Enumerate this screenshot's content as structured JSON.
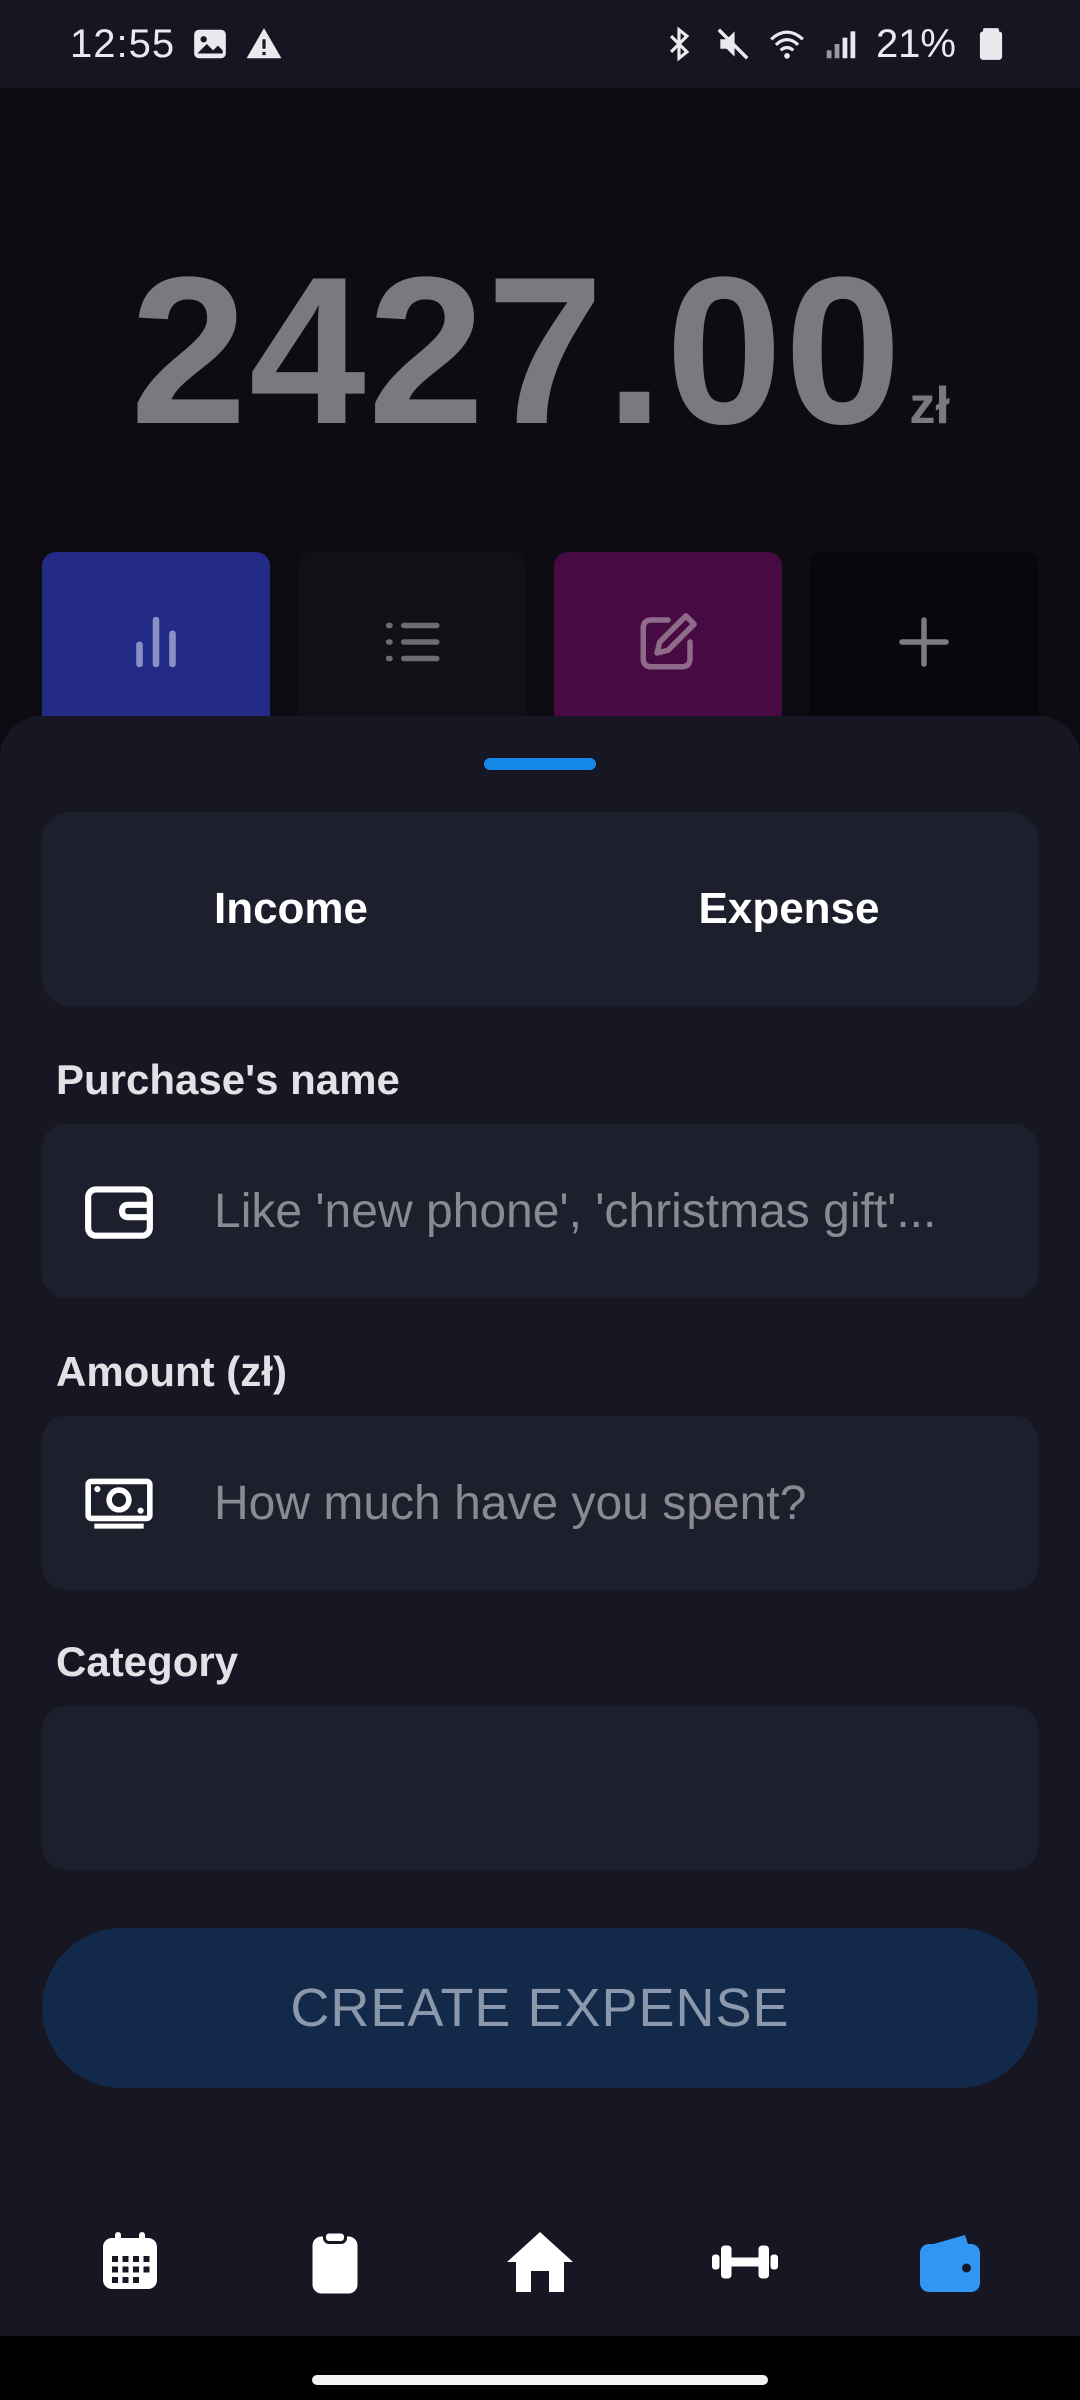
{
  "status_bar": {
    "time": "12:55",
    "battery_percent": "21%",
    "icons_left": [
      "gallery-icon",
      "alert-icon"
    ],
    "icons_right": [
      "bluetooth-icon",
      "mute-icon",
      "wifi-icon",
      "signal-icon",
      "battery-icon"
    ]
  },
  "balance": {
    "amount": "2427.00",
    "currency": "zł"
  },
  "tiles": [
    {
      "icon": "bar-chart-icon",
      "color": "#242b87"
    },
    {
      "icon": "list-icon",
      "color": "#101117"
    },
    {
      "icon": "edit-icon",
      "color": "#480a43"
    },
    {
      "icon": "plus-icon",
      "color": "#07070c"
    }
  ],
  "segment": {
    "income_label": "Income",
    "expense_label": "Expense"
  },
  "form": {
    "name_label": "Purchase's name",
    "name_placeholder": "Like 'new phone', 'christmas gift'...",
    "name_value": "",
    "amount_label": "Amount (zł)",
    "amount_placeholder": "How much have you spent?",
    "amount_value": "",
    "category_label": "Category",
    "submit_label": "CREATE EXPENSE"
  },
  "bottom_nav": {
    "items": [
      "calendar-icon",
      "clipboard-icon",
      "home-icon",
      "dumbbell-icon",
      "wallet-icon"
    ],
    "active": "wallet-icon",
    "active_color": "#2f96f3"
  },
  "colors": {
    "accent": "#1689ea",
    "background": "#0c0c12",
    "sheet": "#161722",
    "field": "#1e1f2d"
  }
}
